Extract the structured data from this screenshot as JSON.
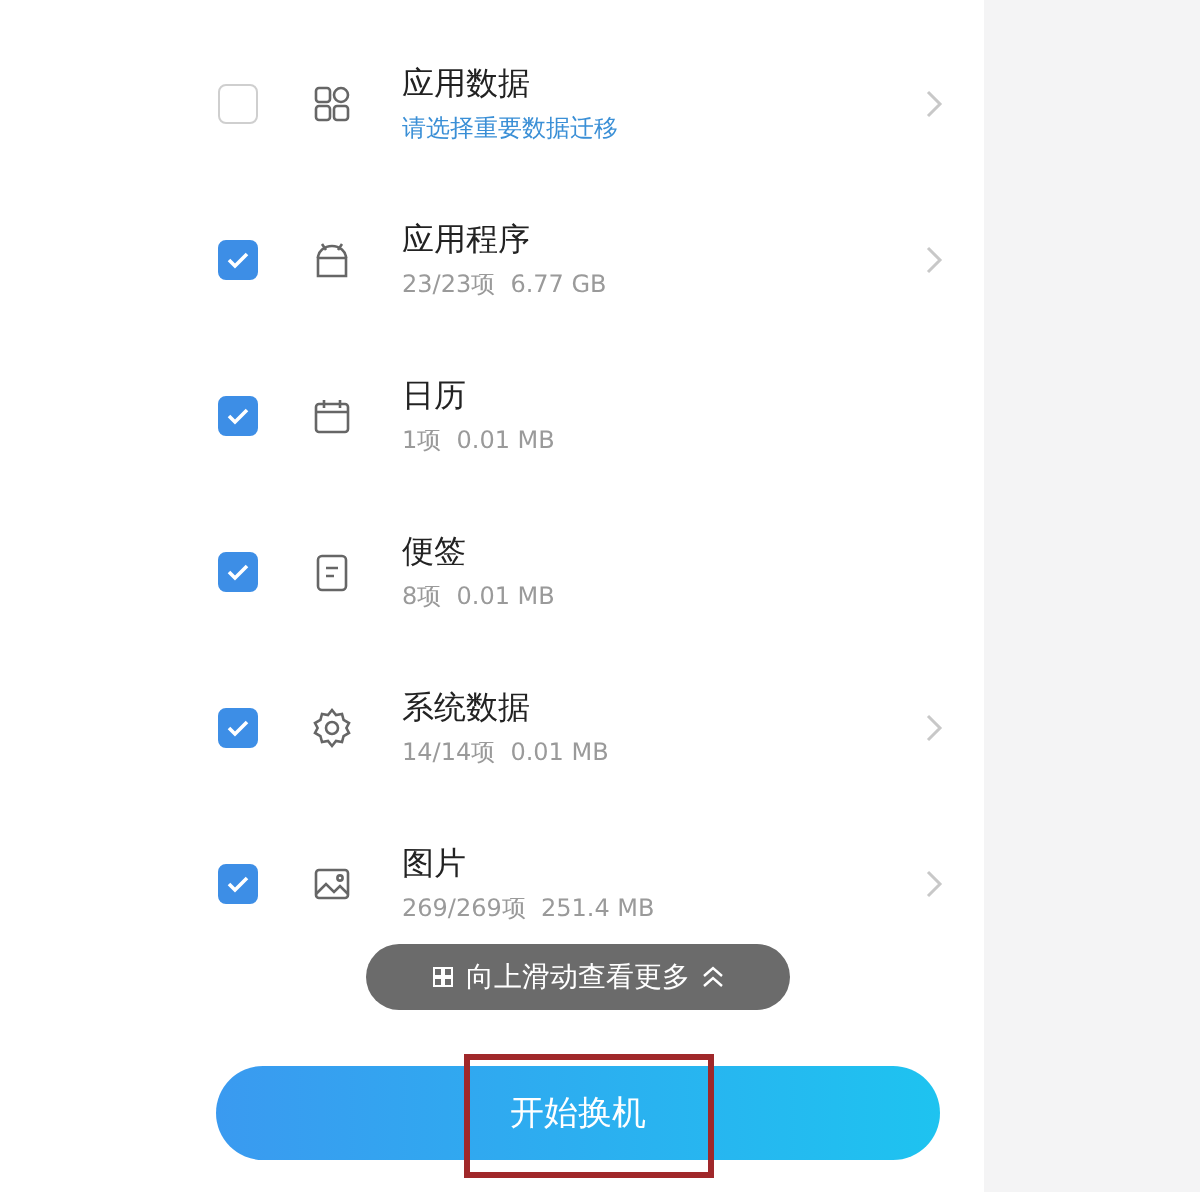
{
  "items": [
    {
      "title": "应用数据",
      "subtitle": "请选择重要数据迁移",
      "kind": "prompt",
      "checked": false,
      "arrow": true
    },
    {
      "title": "应用程序",
      "subtitle": "23/23项  6.77 GB",
      "kind": "summary",
      "checked": true,
      "arrow": true
    },
    {
      "title": "日历",
      "subtitle": "1项  0.01 MB",
      "kind": "summary",
      "checked": true,
      "arrow": false
    },
    {
      "title": "便签",
      "subtitle": "8项  0.01 MB",
      "kind": "summary",
      "checked": true,
      "arrow": false
    },
    {
      "title": "系统数据",
      "subtitle": "14/14项  0.01 MB",
      "kind": "summary",
      "checked": true,
      "arrow": true
    },
    {
      "title": "图片",
      "subtitle": "269/269项  251.4 MB",
      "kind": "summary",
      "checked": true,
      "arrow": true
    }
  ],
  "toast": {
    "text": "向上滑动查看更多"
  },
  "start_button": {
    "label": "开始换机"
  }
}
